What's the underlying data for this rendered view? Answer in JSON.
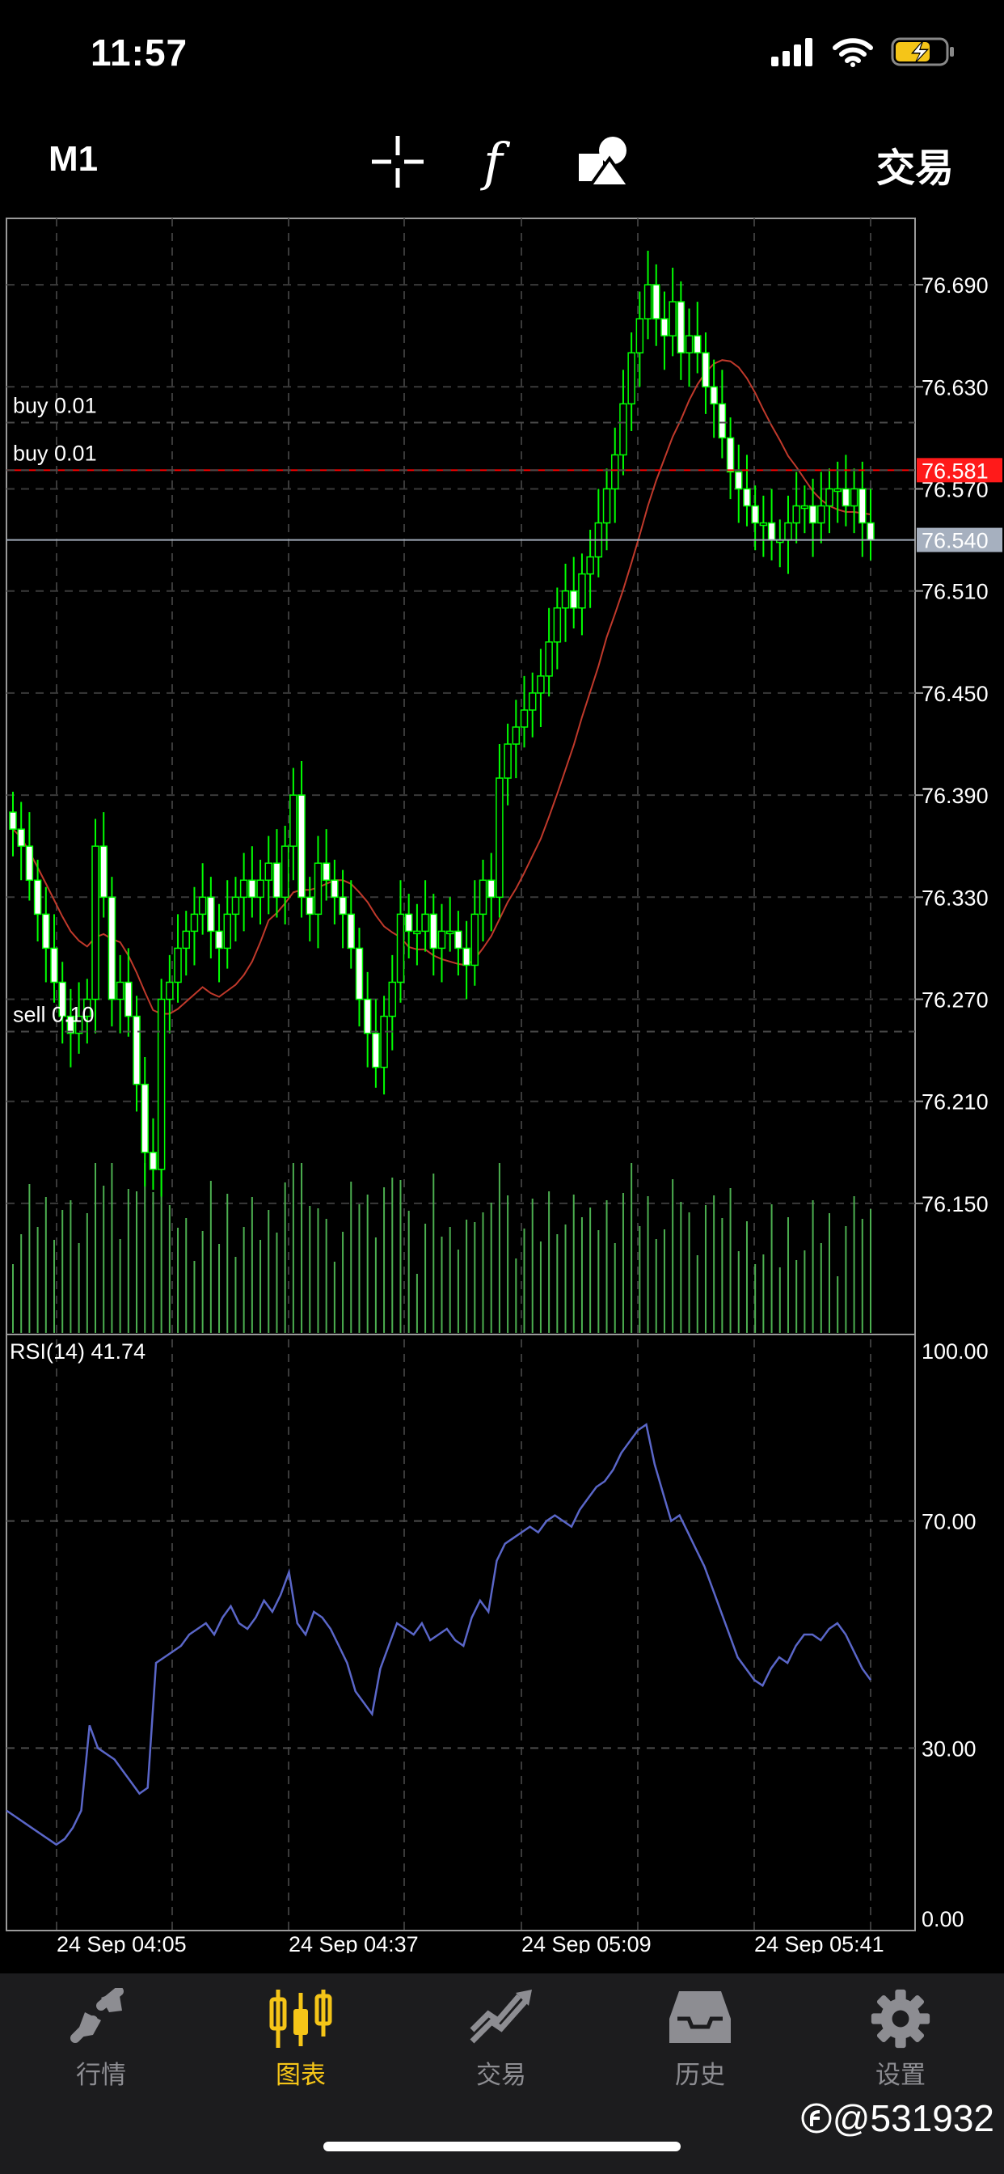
{
  "status_bar": {
    "time": "11:57"
  },
  "toolbar": {
    "timeframe": "M1",
    "trade_label": "交易",
    "icons": [
      "crosshair-icon",
      "function-icon",
      "objects-icon"
    ]
  },
  "chart": {
    "price_axis": [
      "76.690",
      "76.630",
      "76.570",
      "76.510",
      "76.450",
      "76.390",
      "76.330",
      "76.270",
      "76.210",
      "76.150"
    ],
    "ask_price": "76.581",
    "bid_price": "76.540",
    "order_lines": [
      "buy 0.01",
      "buy 0.01",
      "sell 0.10"
    ],
    "rsi_label": "RSI(14) 41.74",
    "rsi_axis": [
      "100.00",
      "70.00",
      "30.00",
      "0.00"
    ],
    "time_axis": [
      "24 Sep 04:05",
      "24 Sep 04:37",
      "24 Sep 05:09",
      "24 Sep 05:41"
    ],
    "colors": {
      "bull": "#ffffff",
      "bear": "#00ff00",
      "ma": "#c0392b",
      "rsi": "#5a66c8",
      "ask": "#ff0000",
      "bid": "#a0aab8"
    }
  },
  "chart_data": {
    "type": "candlestick",
    "symbol_timeframe": "M1",
    "close_approx": [
      76.37,
      76.36,
      76.34,
      76.32,
      76.3,
      76.28,
      76.26,
      76.25,
      76.26,
      76.27,
      76.36,
      76.33,
      76.27,
      76.28,
      76.26,
      76.22,
      76.18,
      76.17,
      76.27,
      76.28,
      76.3,
      76.31,
      76.32,
      76.33,
      76.31,
      76.3,
      76.32,
      76.33,
      76.34,
      76.33,
      76.34,
      76.35,
      76.33,
      76.36,
      76.39,
      76.33,
      76.32,
      76.35,
      76.34,
      76.33,
      76.32,
      76.3,
      76.27,
      76.25,
      76.23,
      76.26,
      76.28,
      76.32,
      76.31,
      76.31,
      76.32,
      76.3,
      76.31,
      76.31,
      76.3,
      76.29,
      76.32,
      76.34,
      76.33,
      76.4,
      76.42,
      76.43,
      76.44,
      76.45,
      76.46,
      76.48,
      76.5,
      76.51,
      76.5,
      76.52,
      76.53,
      76.55,
      76.57,
      76.59,
      76.62,
      76.65,
      76.67,
      76.69,
      76.67,
      76.66,
      76.68,
      76.65,
      76.66,
      76.65,
      76.63,
      76.62,
      76.6,
      76.58,
      76.57,
      76.56,
      76.55,
      76.55,
      76.54,
      76.54,
      76.55,
      76.56,
      76.56,
      76.55,
      76.56,
      76.57,
      76.57,
      76.56,
      76.57,
      76.55,
      76.54
    ],
    "rsi_approx": [
      19,
      18,
      17,
      16,
      15,
      14,
      13,
      14,
      16,
      19,
      34,
      30,
      29,
      28,
      26,
      24,
      22,
      23,
      45,
      46,
      47,
      48,
      50,
      51,
      52,
      50,
      53,
      55,
      52,
      51,
      53,
      56,
      54,
      57,
      61,
      52,
      50,
      54,
      53,
      51,
      48,
      45,
      40,
      38,
      36,
      44,
      48,
      52,
      51,
      50,
      52,
      49,
      50,
      51,
      49,
      48,
      53,
      56,
      54,
      63,
      66,
      67,
      68,
      69,
      68,
      70,
      71,
      70,
      69,
      72,
      74,
      76,
      77,
      79,
      82,
      84,
      86,
      87,
      80,
      75,
      70,
      71,
      68,
      65,
      62,
      58,
      54,
      50,
      46,
      44,
      42,
      41,
      44,
      46,
      45,
      48,
      50,
      50,
      49,
      51,
      52,
      50,
      47,
      44,
      42
    ],
    "ylim": [
      76.13,
      76.71
    ],
    "rsi_ylim": [
      0,
      100
    ]
  },
  "tabbar": {
    "tabs": [
      {
        "label": "行情",
        "icon": "quotes-icon"
      },
      {
        "label": "图表",
        "icon": "chart-icon",
        "active": true
      },
      {
        "label": "交易",
        "icon": "trade-icon"
      },
      {
        "label": "历史",
        "icon": "history-icon"
      },
      {
        "label": "设置",
        "icon": "settings-icon"
      }
    ]
  },
  "watermark": "@531932"
}
